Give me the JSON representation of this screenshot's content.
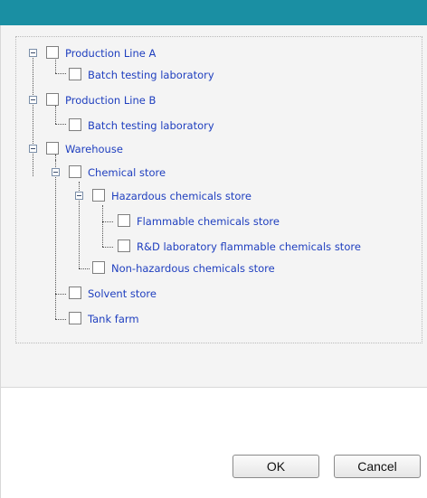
{
  "dialog": {
    "title_bar_color": "#1a8fa3"
  },
  "tree": {
    "nodes": [
      {
        "label": "Production Line A"
      },
      {
        "label": "Batch testing laboratory"
      },
      {
        "label": "Production Line B"
      },
      {
        "label": "Batch testing laboratory"
      },
      {
        "label": "Warehouse"
      },
      {
        "label": "Chemical store"
      },
      {
        "label": "Hazardous chemicals store"
      },
      {
        "label": "Flammable chemicals store"
      },
      {
        "label": "R&D laboratory flammable chemicals store"
      },
      {
        "label": "Non-hazardous chemicals store"
      },
      {
        "label": "Solvent store"
      },
      {
        "label": "Tank farm"
      }
    ]
  },
  "buttons": {
    "ok_label": "OK",
    "cancel_label": "Cancel"
  }
}
